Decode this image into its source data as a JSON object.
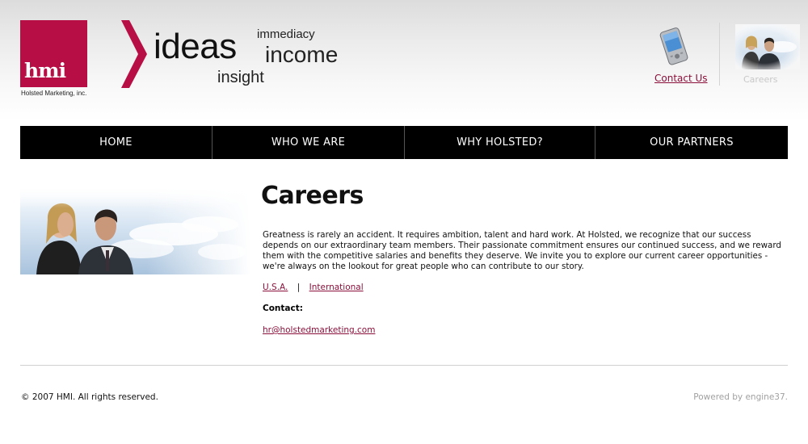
{
  "header": {
    "logo_text": "hmi",
    "logo_subtitle": "Holsted Marketing, inc.",
    "tagline": {
      "ideas": "ideas",
      "immediacy": "immediacy",
      "income": "income",
      "insight": "insight"
    },
    "contact_label": "Contact Us",
    "careers_label": "Careers"
  },
  "nav": {
    "items": [
      {
        "label": "HOME"
      },
      {
        "label": "WHO WE ARE"
      },
      {
        "label": "WHY HOLSTED?"
      },
      {
        "label": "OUR PARTNERS"
      }
    ]
  },
  "main": {
    "title": "Careers",
    "body": "Greatness is rarely an accident. It requires ambition, talent and hard work. At Holsted, we recognize that our success depends on our extraordinary team members. Their passionate commitment ensures our continued success, and we reward them with the competitive salaries and benefits they deserve. We invite you to explore our current career opportunities - we're always on the lookout for great people who can contribute to our story.",
    "links": {
      "usa": "U.S.A.",
      "separator": "|",
      "international": "International"
    },
    "contact_heading": "Contact:",
    "email": "hr@holstedmarketing.com"
  },
  "footer": {
    "copyright": "© 2007 HMI. All rights reserved.",
    "powered_by": "Powered by engine37."
  },
  "colors": {
    "brand": "#b70f45",
    "link": "#8a0f3a",
    "nav_bg": "#000000"
  },
  "icons": {
    "phone": "phone-icon",
    "careers_photo": "careers-thumbnail-icon",
    "chevron": "chevron-right-icon"
  }
}
